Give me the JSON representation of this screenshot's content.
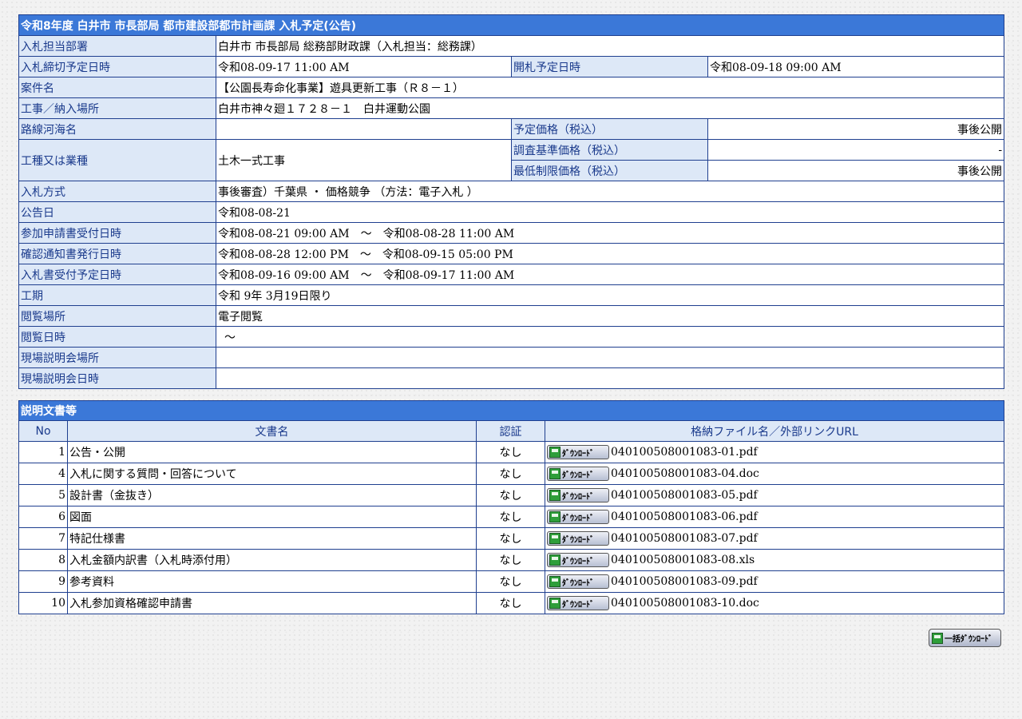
{
  "info": {
    "header": "令和8年度 白井市 市長部局 都市建設部都市計画課 入札予定(公告)",
    "dept_label": "入札担当部署",
    "dept_value": "白井市 市長部局 総務部財政課（入札担当：総務課）",
    "deadline_label": "入札締切予定日時",
    "deadline_value": "令和08-09-17 11:00 AM",
    "opening_label": "開札予定日時",
    "opening_value": "令和08-09-18 09:00 AM",
    "case_label": "案件名",
    "case_value": "【公園長寿命化事業】遊具更新工事（Ｒ８－１）",
    "place_label": "工事／納入場所",
    "place_value": "白井市神々廻１７２８－１　白井運動公園",
    "route_label": "路線河海名",
    "route_value": "",
    "planned_price_label": "予定価格（税込）",
    "planned_price_value": "事後公開",
    "work_type_label": "工種又は業種",
    "work_type_value": "土木一式工事",
    "survey_price_label": "調査基準価格（税込）",
    "survey_price_value": "-",
    "min_price_label": "最低制限価格（税込）",
    "min_price_value": "事後公開",
    "method_label": "入札方式",
    "method_value": "事後審査）千葉県 ・ 価格競争 （方法：電子入札 ）",
    "notice_label": "公告日",
    "notice_value": "令和08-08-21",
    "apply_label": "参加申請書受付日時",
    "apply_value": "令和08-08-21 09:00 AM　～　令和08-08-28 11:00 AM",
    "confirm_label": "確認通知書発行日時",
    "confirm_value": "令和08-08-28 12:00 PM　～　令和08-09-15 05:00 PM",
    "bid_accept_label": "入札書受付予定日時",
    "bid_accept_value": "令和08-09-16 09:00 AM　～　令和08-09-17 11:00 AM",
    "period_label": "工期",
    "period_value": "令和 9年 3月19日限り",
    "view_place_label": "閲覧場所",
    "view_place_value": "電子閲覧",
    "view_date_label": "閲覧日時",
    "view_date_value": "～",
    "site_place_label": "現場説明会場所",
    "site_place_value": "",
    "site_date_label": "現場説明会日時",
    "site_date_value": ""
  },
  "docs": {
    "header": "説明文書等",
    "col_no": "No",
    "col_name": "文書名",
    "col_cert": "認証",
    "col_file": "格納ファイル名／外部リンクURL",
    "download_label": "ﾀﾞｳﾝﾛｰﾄﾞ",
    "rows": [
      {
        "no": "1",
        "name": "公告・公開",
        "cert": "なし",
        "file": "040100508001083-01.pdf"
      },
      {
        "no": "4",
        "name": "入札に関する質問・回答について",
        "cert": "なし",
        "file": "040100508001083-04.doc"
      },
      {
        "no": "5",
        "name": "設計書（金抜き）",
        "cert": "なし",
        "file": "040100508001083-05.pdf"
      },
      {
        "no": "6",
        "name": "図面",
        "cert": "なし",
        "file": "040100508001083-06.pdf"
      },
      {
        "no": "7",
        "name": "特記仕様書",
        "cert": "なし",
        "file": "040100508001083-07.pdf"
      },
      {
        "no": "8",
        "name": "入札金額内訳書（入札時添付用）",
        "cert": "なし",
        "file": "040100508001083-08.xls"
      },
      {
        "no": "9",
        "name": "参考資料",
        "cert": "なし",
        "file": "040100508001083-09.pdf"
      },
      {
        "no": "10",
        "name": "入札参加資格確認申請書",
        "cert": "なし",
        "file": "040100508001083-10.doc"
      }
    ]
  },
  "bulk_download_label": "一括ﾀﾞｳﾝﾛｰﾄﾞ",
  "icons": {
    "download": "floppy-disk-icon"
  }
}
